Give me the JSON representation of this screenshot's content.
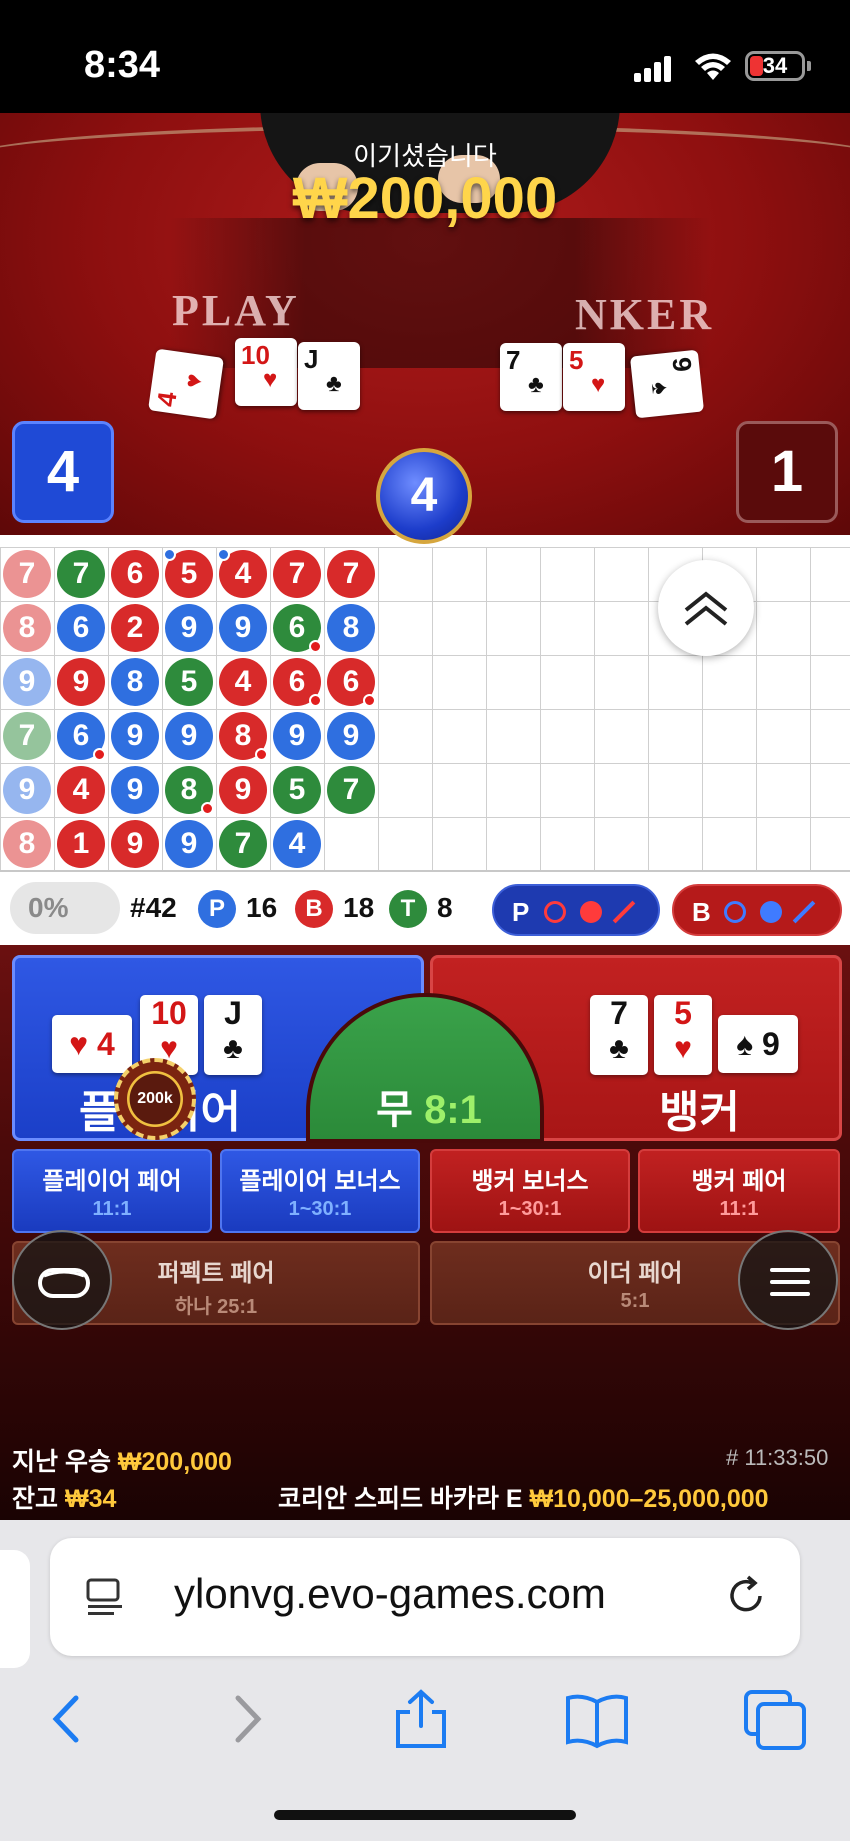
{
  "status_bar": {
    "time": "8:34",
    "battery": "34"
  },
  "video": {
    "win_title": "이기셨습니다",
    "win_amount": "₩200,000",
    "player_label_partial": "PLAY",
    "banker_label_partial": "NKER",
    "player_cards": [
      {
        "rank": "4",
        "suit": "♥",
        "color": "red"
      },
      {
        "rank": "10",
        "suit": "♥",
        "color": "red"
      },
      {
        "rank": "J",
        "suit": "♣",
        "color": "black"
      }
    ],
    "banker_cards": [
      {
        "rank": "7",
        "suit": "♣",
        "color": "black"
      },
      {
        "rank": "5",
        "suit": "♥",
        "color": "red"
      },
      {
        "rank": "9",
        "suit": "♠",
        "color": "black"
      }
    ],
    "player_score": "4",
    "banker_score": "1",
    "result_ball": "4"
  },
  "bead_road": {
    "columns": [
      [
        "7B",
        "8B",
        "9P",
        "7T",
        "9P",
        "8B"
      ],
      [
        "7T",
        "6P",
        "9B",
        "6P",
        "4B",
        "1B"
      ],
      [
        "6B",
        "2B",
        "8P",
        "9P",
        "9P",
        "9B"
      ],
      [
        "5B",
        "9P",
        "5T",
        "9P",
        "8T",
        "9P"
      ],
      [
        "4B",
        "9P",
        "4B",
        "8B",
        "9B",
        "7T"
      ],
      [
        "7B",
        "6T",
        "6B",
        "9P",
        "5T",
        "4P"
      ],
      [
        "7B",
        "8P",
        "6B",
        "9P",
        "7T",
        ""
      ]
    ]
  },
  "stats": {
    "percent": "0%",
    "round": "#42",
    "player_letter": "P",
    "player_count": "16",
    "banker_letter": "B",
    "banker_count": "18",
    "tie_letter": "T",
    "tie_count": "8",
    "predict_player": "P",
    "predict_banker": "B"
  },
  "betting": {
    "player_label": "플레이어",
    "banker_label": "뱅커",
    "tie_label": "무",
    "tie_odds": "8:1",
    "chip_value": "200k",
    "side_bets": [
      {
        "label": "플레이어 페어",
        "odds": "11:1"
      },
      {
        "label": "플레이어 보너스",
        "odds": "1~30:1"
      },
      {
        "label": "뱅커 보너스",
        "odds": "1~30:1"
      },
      {
        "label": "뱅커 페어",
        "odds": "11:1"
      },
      {
        "label": "퍼펙트 페어",
        "odds": "하나 25:1"
      },
      {
        "label": "이더 페어",
        "odds": "5:1"
      }
    ],
    "last_win_label": "지난 우승",
    "last_win_amount": "₩200,000",
    "balance_label": "잔고",
    "balance_amount": "₩34",
    "round_id": "# 11:33:50",
    "table_name": "코리안 스피드 바카라 E",
    "limits": "₩10,000–25,000,000"
  },
  "browser": {
    "url": "ylonvg.evo-games.com"
  }
}
